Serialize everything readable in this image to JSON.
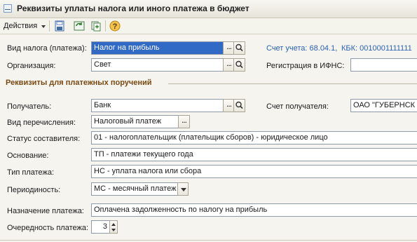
{
  "window": {
    "title": "Реквизиты уплаты налога или иного платежа в бюджет"
  },
  "toolbar": {
    "actions_label": "Действия"
  },
  "form": {
    "tax_type": {
      "label": "Вид налога (платежа):",
      "value": "Налог на прибыль"
    },
    "account": {
      "label": "Счет учета: 68.04.1,",
      "kbk": "КБК: 0010001111111"
    },
    "organization": {
      "label": "Организация:",
      "value": "Свет"
    },
    "ifns": {
      "label": "Регистрация в ИФНС:",
      "value": ""
    },
    "section_title": "Реквизиты для платежных поручений",
    "recipient": {
      "label": "Получатель:",
      "value": "Банк"
    },
    "recipient_account": {
      "label": "Счет получателя:",
      "value": "ОАО \"ГУБЕРНСК"
    },
    "transfer_type": {
      "label": "Вид перечисления:",
      "value": "Налоговый платеж"
    },
    "status": {
      "label": "Статус составителя:",
      "value": "01 - налогоплательщик (плательщик сборов) - юридическое лицо"
    },
    "basis": {
      "label": "Основание:",
      "value": "ТП - платежи текущего года"
    },
    "payment_type": {
      "label": "Тип платежа:",
      "value": "НС - уплата налога или сбора"
    },
    "periodicity": {
      "label": "Периодиность:",
      "value": "МС - месячный платеж"
    },
    "purpose": {
      "label": "Назначение платежа:",
      "value": "Оплачена задолженность по налогу на прибыль"
    },
    "priority": {
      "label": "Очередность платежа:",
      "value": "3"
    }
  },
  "icons": {
    "title": "form-icon",
    "toolbar": [
      "save-icon",
      "refresh-icon",
      "copy-icon",
      "help-icon"
    ],
    "field_buttons": [
      "ellipsis-icon",
      "search-icon",
      "dropdown-icon",
      "spin-icon"
    ]
  },
  "colors": {
    "selection": "#3169c6",
    "section_title": "#7a4a12",
    "info_text": "#2a62b8"
  }
}
